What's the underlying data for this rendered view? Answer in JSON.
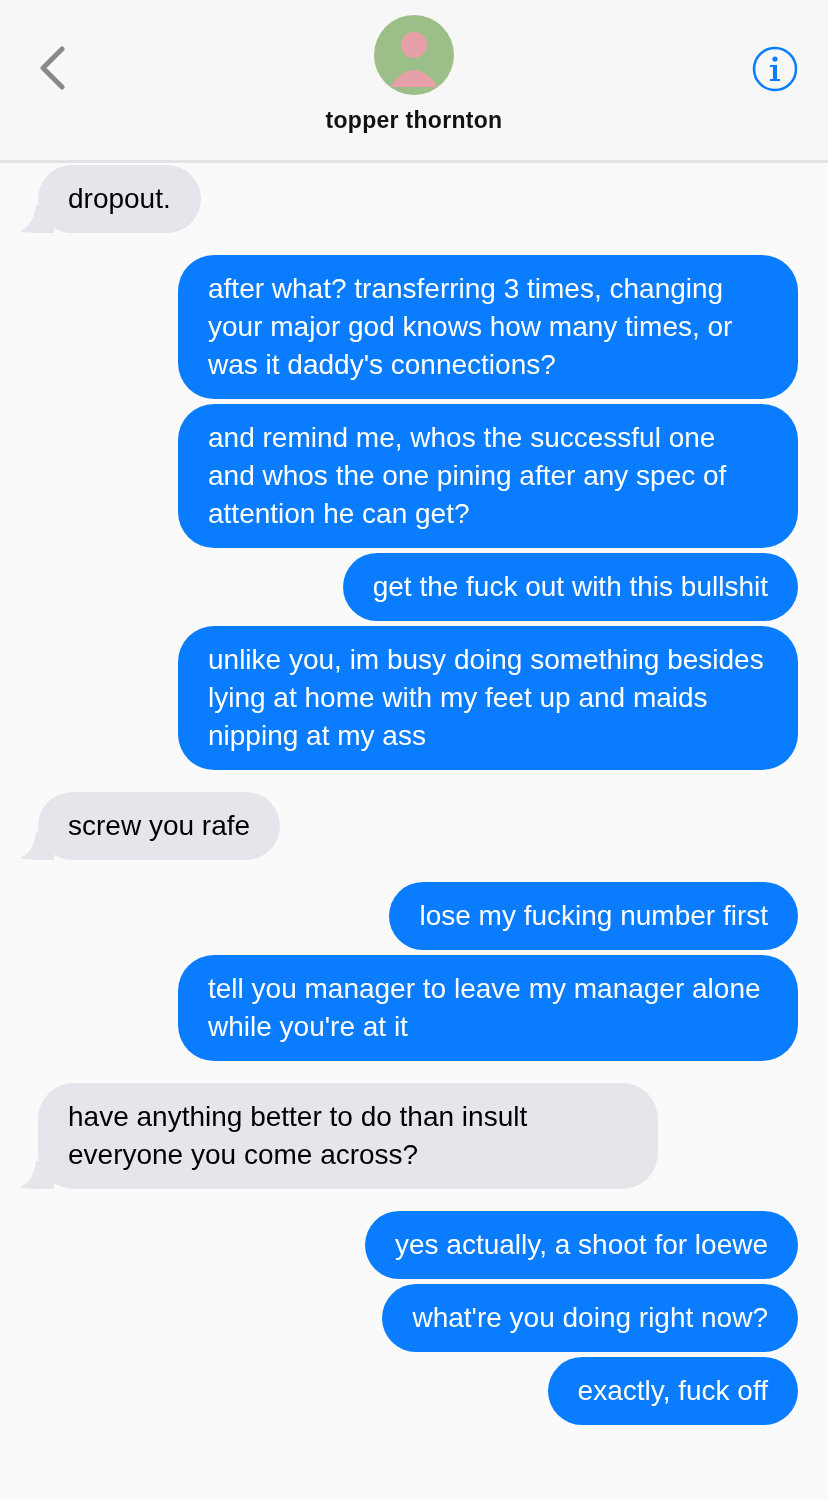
{
  "header": {
    "contact_name": "topper thornton"
  },
  "groups": [
    {
      "kind": "incoming",
      "messages": [
        "dropout."
      ]
    },
    {
      "kind": "outgoing",
      "messages": [
        "after what? transferring 3 times, changing your major god knows how many times, or was it daddy's connections?",
        "and remind me, whos the successful one and whos the one pining after any spec of attention he can get?",
        "get the fuck out with this bullshit",
        "unlike you, im busy doing something besides lying at home with my feet up and maids nipping at my ass"
      ]
    },
    {
      "kind": "incoming",
      "messages": [
        "screw you rafe"
      ]
    },
    {
      "kind": "outgoing",
      "messages": [
        "lose my fucking number first",
        "tell you manager to leave my manager alone while you're at it"
      ]
    },
    {
      "kind": "incoming",
      "messages": [
        "have anything better to do than insult everyone you come across?"
      ]
    },
    {
      "kind": "outgoing",
      "messages": [
        "yes actually, a shoot for loewe",
        "what're you doing right now?",
        "exactly, fuck off"
      ]
    }
  ]
}
